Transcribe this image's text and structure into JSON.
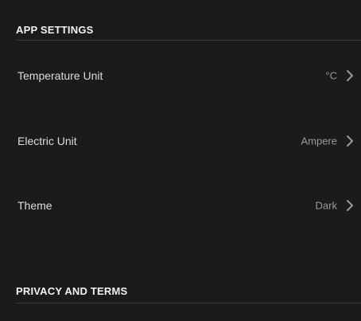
{
  "sections": {
    "app_settings": {
      "title": "APP SETTINGS"
    },
    "privacy_terms": {
      "title": "PRIVACY AND TERMS"
    }
  },
  "settings": [
    {
      "label": "Temperature Unit",
      "value": "°C",
      "icon": "chevron-right-icon"
    },
    {
      "label": "Electric Unit",
      "value": "Ampere",
      "icon": "chevron-right-icon"
    },
    {
      "label": "Theme",
      "value": "Dark",
      "icon": "chevron-right-icon"
    }
  ],
  "colors": {
    "background": "#1b1b1b",
    "header_text": "#f2f2f2",
    "label_text": "#dcdcdc",
    "value_text": "#9a9a9a",
    "divider": "#3a3a3a"
  }
}
